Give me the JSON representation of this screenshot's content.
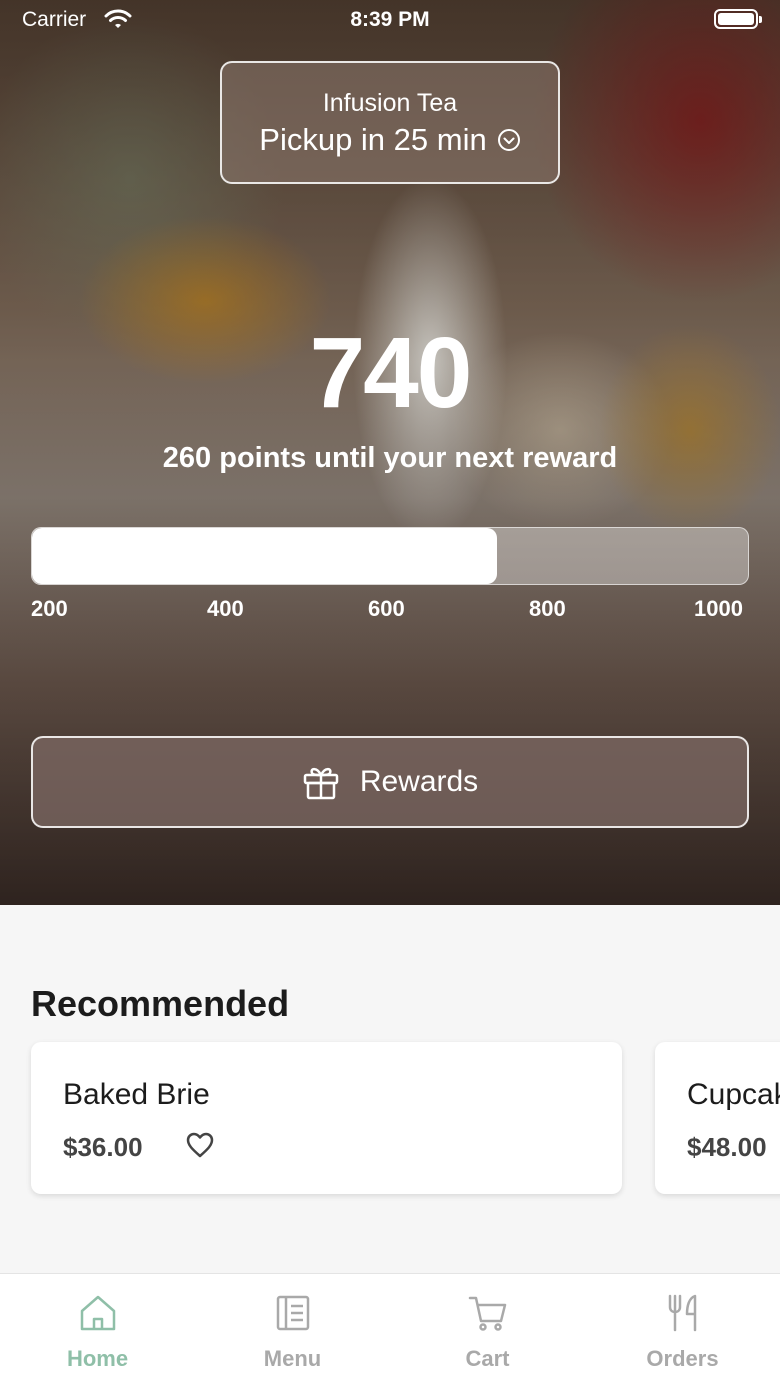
{
  "status_bar": {
    "carrier": "Carrier",
    "time": "8:39 PM"
  },
  "pickup": {
    "store_name": "Infusion Tea",
    "pickup_text": "Pickup in 25 min"
  },
  "rewards": {
    "points": "740",
    "caption": "260 points until your next reward",
    "progress_fraction": 0.65,
    "ticks": [
      "200",
      "400",
      "600",
      "800",
      "1000"
    ],
    "button_label": "Rewards"
  },
  "recommended": {
    "title": "Recommended",
    "items": [
      {
        "name": "Baked Brie",
        "price": "$36.00"
      },
      {
        "name": "Cupcake",
        "price": "$48.00"
      }
    ]
  },
  "tabs": [
    {
      "label": "Home",
      "icon": "home-icon",
      "active": true
    },
    {
      "label": "Menu",
      "icon": "menu-icon",
      "active": false
    },
    {
      "label": "Cart",
      "icon": "cart-icon",
      "active": false
    },
    {
      "label": "Orders",
      "icon": "utensils-icon",
      "active": false
    }
  ],
  "colors": {
    "active_tab": "#8fbfa8",
    "inactive_tab": "#a9a9a9",
    "hero_overlay": "#7d6964"
  }
}
